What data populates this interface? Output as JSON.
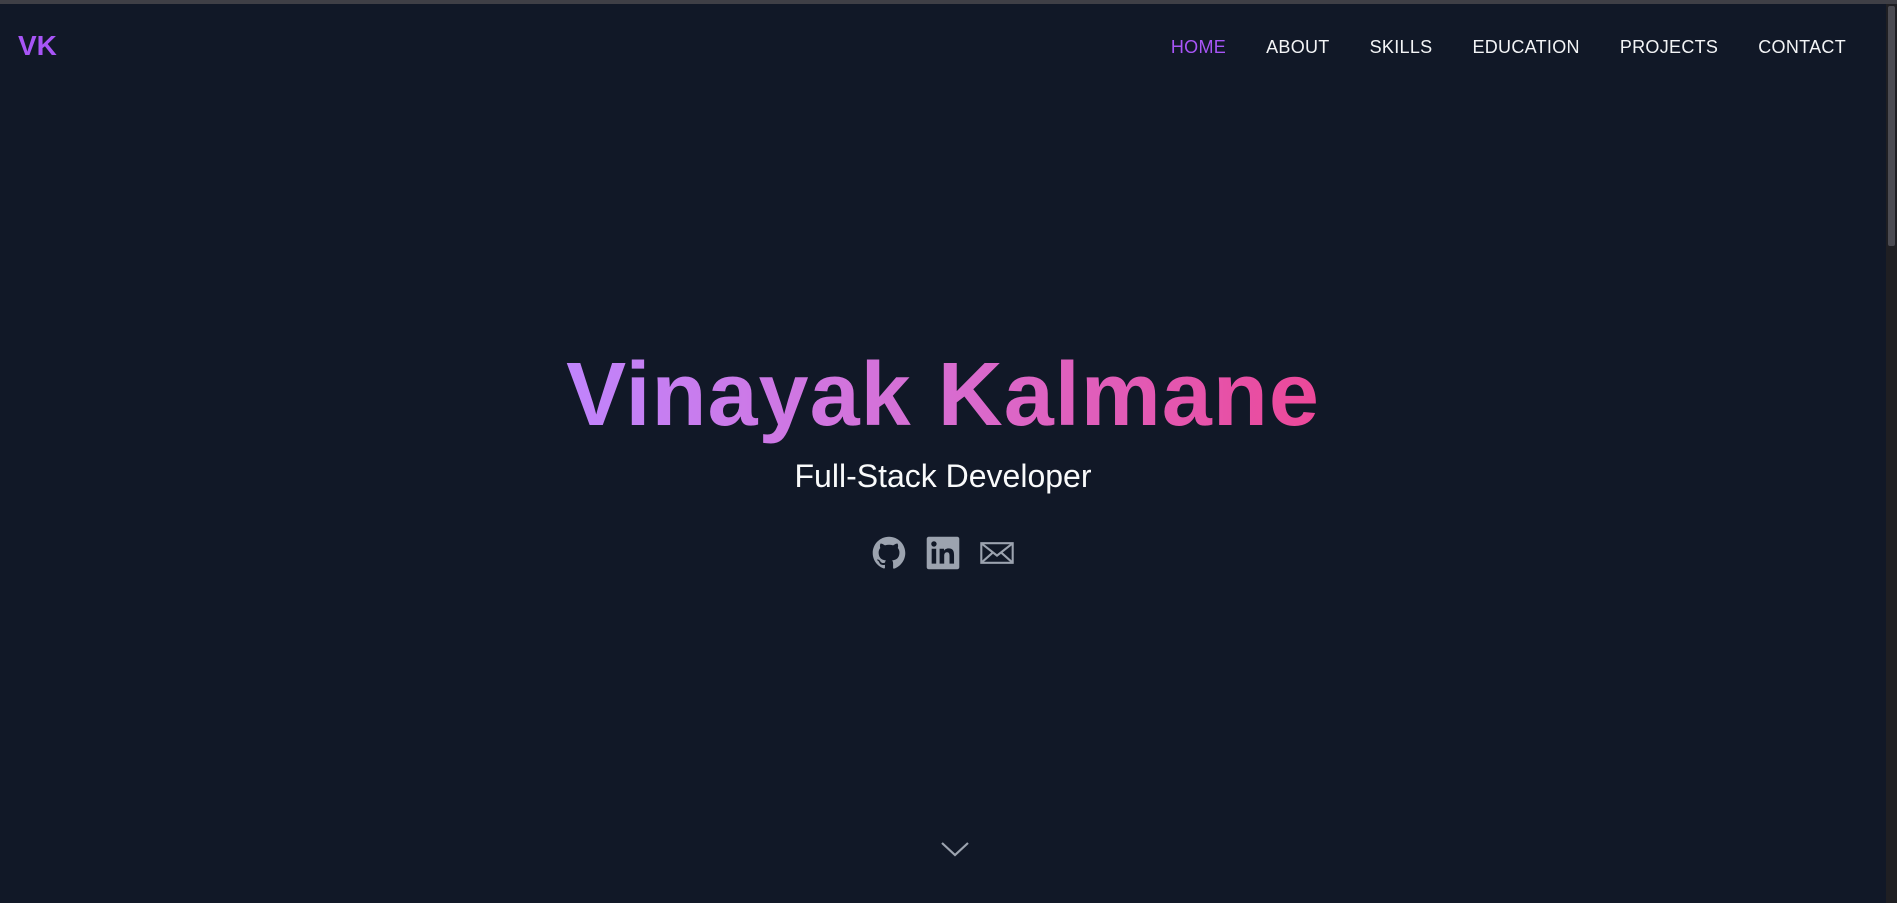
{
  "logo": {
    "text": "VK"
  },
  "nav": {
    "items": [
      {
        "label": "HOME"
      },
      {
        "label": "ABOUT"
      },
      {
        "label": "SKILLS"
      },
      {
        "label": "EDUCATION"
      },
      {
        "label": "PROJECTS"
      },
      {
        "label": "CONTACT"
      }
    ],
    "active": "HOME"
  },
  "hero": {
    "name": "Vinayak Kalmane",
    "role": "Full-Stack Developer"
  },
  "socials": [
    {
      "icon": "github-icon"
    },
    {
      "icon": "linkedin-icon"
    },
    {
      "icon": "mail-icon"
    }
  ],
  "scroll_hint": {
    "icon": "chevron-down-icon"
  },
  "colors": {
    "background": "#111827",
    "accent": "#a855f7",
    "gradient_start": "#c084fc",
    "gradient_end": "#ec4899",
    "icon": "#9ca3af",
    "text": "#f9fafb"
  }
}
